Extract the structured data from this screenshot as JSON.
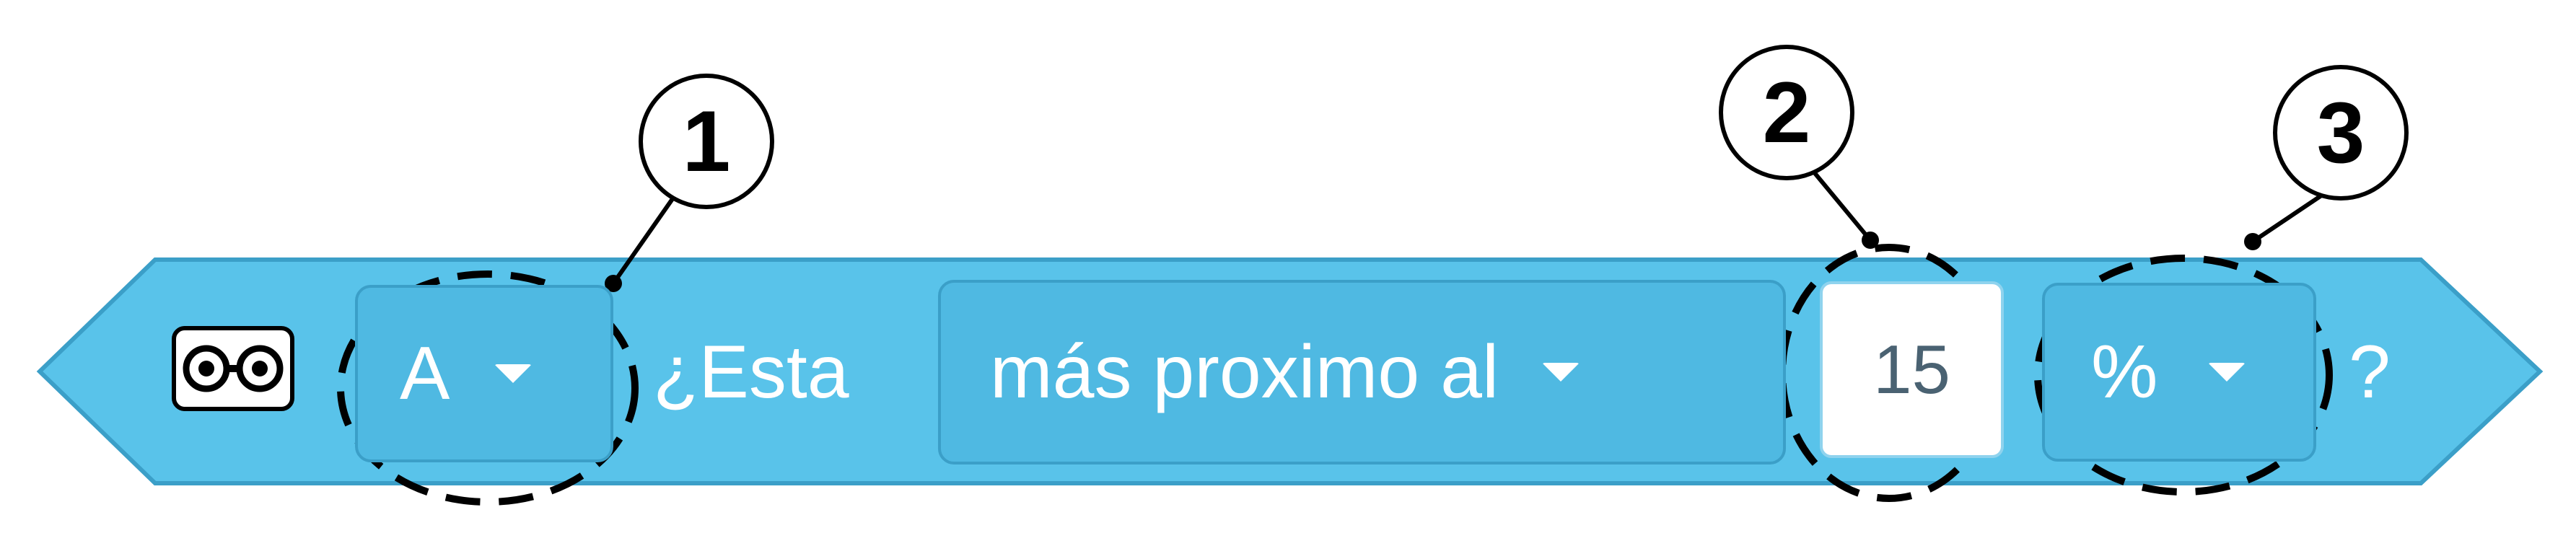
{
  "block": {
    "sensor_icon": "ultrasonic-sensor-icon",
    "port_dropdown": {
      "value": "A"
    },
    "question_prefix": "¿Esta",
    "comparison_dropdown": {
      "value": "más proximo al"
    },
    "distance_input": {
      "value": "15"
    },
    "unit_dropdown": {
      "value": "%"
    },
    "question_suffix": "?"
  },
  "callouts": [
    {
      "number": "1"
    },
    {
      "number": "2"
    },
    {
      "number": "3"
    }
  ],
  "colors": {
    "block_fill": "#59c3ea",
    "block_border": "#3b9fc8",
    "dropdown_fill": "#4fb9e2",
    "callout_stroke": "#000000"
  }
}
